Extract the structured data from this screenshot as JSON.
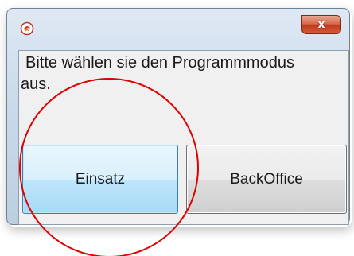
{
  "dialog": {
    "message_line1": "Bitte wählen sie den Programmmodus",
    "message_line2": "aus.",
    "close_symbol": "x",
    "icon": "app-swirl-icon"
  },
  "buttons": {
    "einsatz_label": "Einsatz",
    "backoffice_label": "BackOffice"
  },
  "colors": {
    "annotation": "#e00000",
    "close_button": "#c9472a",
    "focused_button_border": "#3c7fb1"
  }
}
